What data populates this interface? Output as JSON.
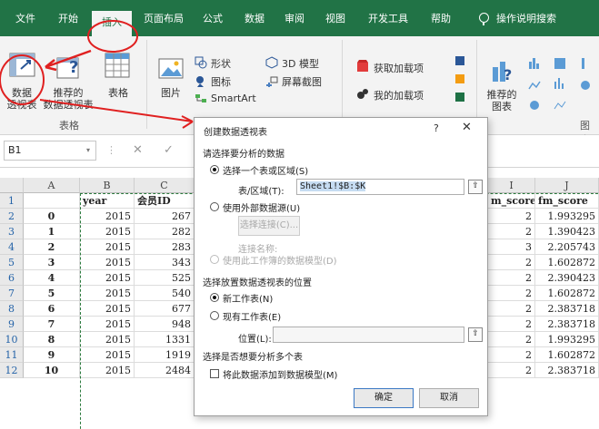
{
  "menu": {
    "tabs": [
      "文件",
      "开始",
      "插入",
      "页面布局",
      "公式",
      "数据",
      "审阅",
      "视图",
      "开发工具",
      "帮助"
    ],
    "active_tab": "插入",
    "tell_me": "操作说明搜索"
  },
  "ribbon": {
    "pivot_table": "数据\n透视表",
    "recommended_pivot": "推荐的\n数据透视表",
    "table": "表格",
    "group_tables": "表格",
    "picture": "图片",
    "shapes": "形状",
    "icons": "图标",
    "smartart": "SmartArt",
    "model3d": "3D 模型",
    "screenshot": "屏幕截图",
    "get_addins": "获取加载项",
    "my_addins": "我的加载项",
    "rec_charts": "推荐的\n图表",
    "charts_group": "图表"
  },
  "formula_bar": {
    "name_box": "B1",
    "dropdown": "▾",
    "dots": "⋮",
    "cancel": "✕",
    "enter": "✓"
  },
  "grid": {
    "columns": [
      "A",
      "B",
      "C",
      "I",
      "J"
    ],
    "rows": [
      "1",
      "2",
      "3",
      "4",
      "5",
      "6",
      "7",
      "8",
      "9",
      "10",
      "11",
      "12"
    ],
    "header_row": {
      "b": "year",
      "c": "会员ID",
      "i": "m_score",
      "j": "fm_score"
    },
    "data": [
      {
        "a": "0",
        "b": "2015",
        "c": "267",
        "i": "2",
        "j": "1.993295"
      },
      {
        "a": "1",
        "b": "2015",
        "c": "282",
        "i": "2",
        "j": "1.390423"
      },
      {
        "a": "2",
        "b": "2015",
        "c": "283",
        "i": "3",
        "j": "2.205743"
      },
      {
        "a": "3",
        "b": "2015",
        "c": "343",
        "i": "2",
        "j": "1.602872"
      },
      {
        "a": "4",
        "b": "2015",
        "c": "525",
        "i": "2",
        "j": "2.390423"
      },
      {
        "a": "5",
        "b": "2015",
        "c": "540",
        "i": "2",
        "j": "1.602872"
      },
      {
        "a": "6",
        "b": "2015",
        "c": "677",
        "i": "2",
        "j": "2.383718"
      },
      {
        "a": "7",
        "b": "2015",
        "c": "948",
        "i": "2",
        "j": "2.383718"
      },
      {
        "a": "8",
        "b": "2015",
        "c": "1331",
        "i": "2",
        "j": "1.993295"
      },
      {
        "a": "9",
        "b": "2015",
        "c": "1919",
        "i": "2",
        "j": "1.602872"
      },
      {
        "a": "10",
        "b": "2015",
        "c": "2484",
        "i": "2",
        "j": "2.383718"
      }
    ]
  },
  "dialog": {
    "title": "创建数据透视表",
    "help": "?",
    "close": "✕",
    "section1": "请选择要分析的数据",
    "opt_range": "选择一个表或区域(S)",
    "range_label": "表/区域(T):",
    "range_value": "Sheet1!$B:$K",
    "opt_external": "使用外部数据源(U)",
    "choose_conn": "选择连接(C)...",
    "conn_name": "连接名称:",
    "opt_datamodel": "使用此工作簿的数据模型(D)",
    "section2": "选择放置数据透视表的位置",
    "opt_new_sheet": "新工作表(N)",
    "opt_existing_sheet": "现有工作表(E)",
    "location_label": "位置(L):",
    "location_value": "",
    "section3": "选择是否想要分析多个表",
    "add_to_model": "将此数据添加到数据模型(M)",
    "ok": "确定",
    "cancel": "取消",
    "ref_icon": "⇧"
  }
}
